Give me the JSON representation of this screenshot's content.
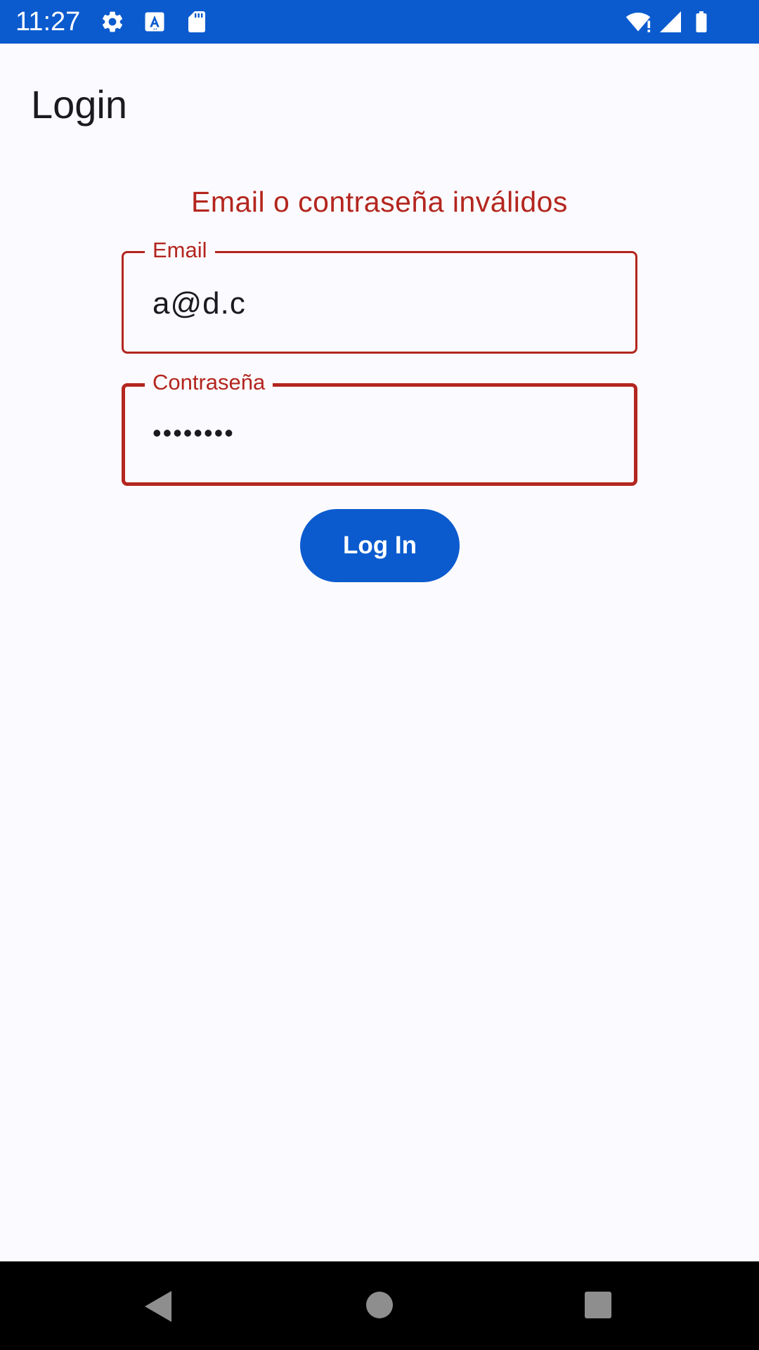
{
  "status_bar": {
    "time": "11:27",
    "icons": [
      "gear-icon",
      "text-a-icon",
      "sd-card-icon",
      "wifi-alert-icon",
      "cell-signal-icon",
      "battery-icon"
    ],
    "background_color": "#0b5bcf"
  },
  "header": {
    "title": "Login"
  },
  "form": {
    "error_message": "Email o contraseña inválidos",
    "email": {
      "label": "Email",
      "value": "a@d.c"
    },
    "password": {
      "label": "Contraseña",
      "value": "••••••••"
    },
    "login_button": "Log In",
    "error_color": "#b3261e",
    "accent_color": "#0b5bcf"
  },
  "navigation_bar": {
    "buttons": [
      "back-icon",
      "home-icon",
      "recents-icon"
    ]
  }
}
